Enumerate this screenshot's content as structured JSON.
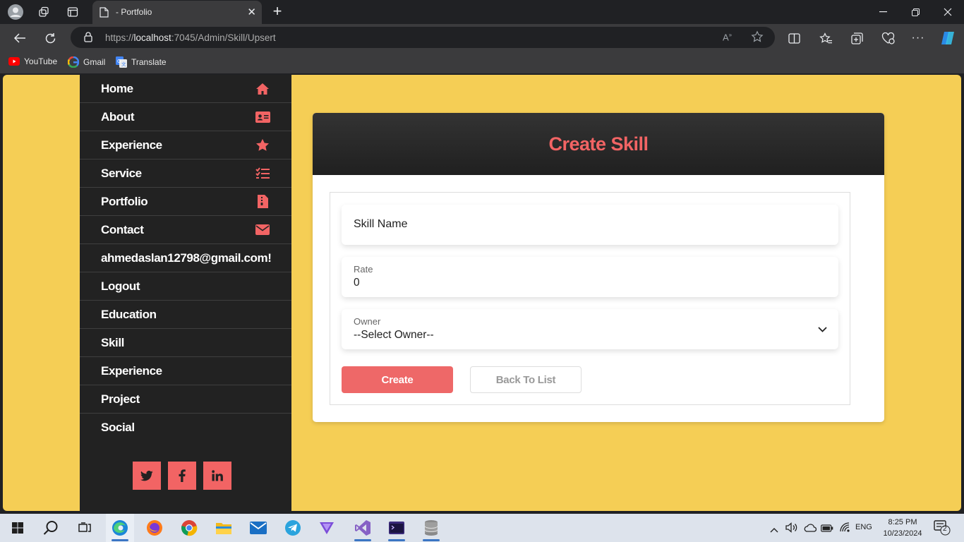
{
  "browser": {
    "tab_title": "- Portfolio",
    "url_prefix": "https://",
    "url_host": "localhost",
    "url_rest": ":7045/Admin/Skill/Upsert",
    "bookmarks": [
      {
        "label": "YouTube",
        "icon": "youtube-icon"
      },
      {
        "label": "Gmail",
        "icon": "google-icon"
      },
      {
        "label": "Translate",
        "icon": "translate-icon"
      }
    ]
  },
  "sidebar": {
    "items": [
      {
        "label": "Home",
        "icon": "home-icon"
      },
      {
        "label": "About",
        "icon": "id-card-icon"
      },
      {
        "label": "Experience",
        "icon": "star-icon"
      },
      {
        "label": "Service",
        "icon": "checklist-icon"
      },
      {
        "label": "Portfolio",
        "icon": "file-zip-icon"
      },
      {
        "label": "Contact",
        "icon": "envelope-icon"
      },
      {
        "label": "ahmedaslan12798@gmail.com!",
        "icon": ""
      },
      {
        "label": "Logout",
        "icon": ""
      },
      {
        "label": "Education",
        "icon": ""
      },
      {
        "label": "Skill",
        "icon": ""
      },
      {
        "label": "Experience",
        "icon": ""
      },
      {
        "label": "Project",
        "icon": ""
      },
      {
        "label": "Social",
        "icon": ""
      }
    ],
    "socials": [
      "twitter-icon",
      "facebook-icon",
      "linkedin-icon"
    ]
  },
  "form": {
    "title": "Create Skill",
    "skill_name_placeholder": "Skill Name",
    "rate_label": "Rate",
    "rate_value": "0",
    "owner_label": "Owner",
    "owner_value": "--Select Owner--",
    "create_label": "Create",
    "back_label": "Back To List"
  },
  "taskbar": {
    "lang": "ENG",
    "time": "8:25 PM",
    "date": "10/23/2024",
    "notifications": "2"
  },
  "colors": {
    "page_bg": "#f5ce55",
    "sidebar_bg": "#222222",
    "accent": "#f26464"
  }
}
